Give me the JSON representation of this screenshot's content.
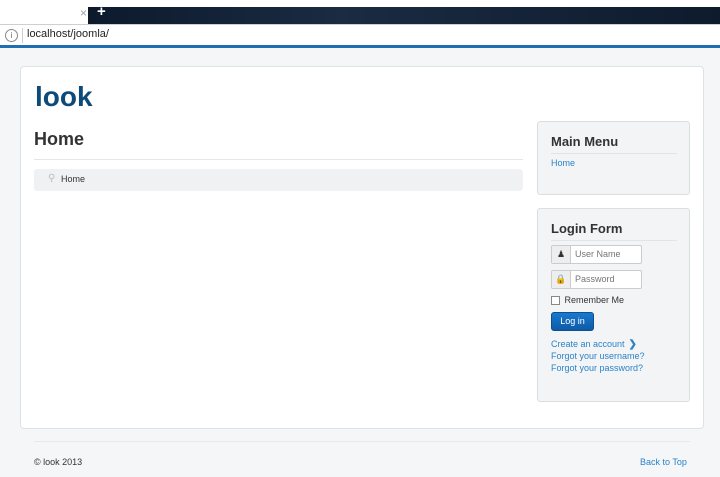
{
  "browser": {
    "url": "localhost/joomla/",
    "close_tab": "×",
    "new_tab": "+"
  },
  "site": {
    "brand": "look",
    "page_title": "Home",
    "breadcrumb": [
      "Home"
    ]
  },
  "main_menu": {
    "title": "Main Menu",
    "items": [
      "Home"
    ]
  },
  "login_form": {
    "title": "Login Form",
    "username_placeholder": "User Name",
    "password_placeholder": "Password",
    "remember_label": "Remember Me",
    "login_button": "Log in",
    "links": [
      "Create an account",
      "Forgot your username?",
      "Forgot your password?"
    ]
  },
  "footer": {
    "copyright": "© look 2013",
    "back_to_top": "Back to Top"
  },
  "colors": {
    "accent": "#2b83c8",
    "brand": "#0d4a78",
    "button": "#1a78d0"
  }
}
